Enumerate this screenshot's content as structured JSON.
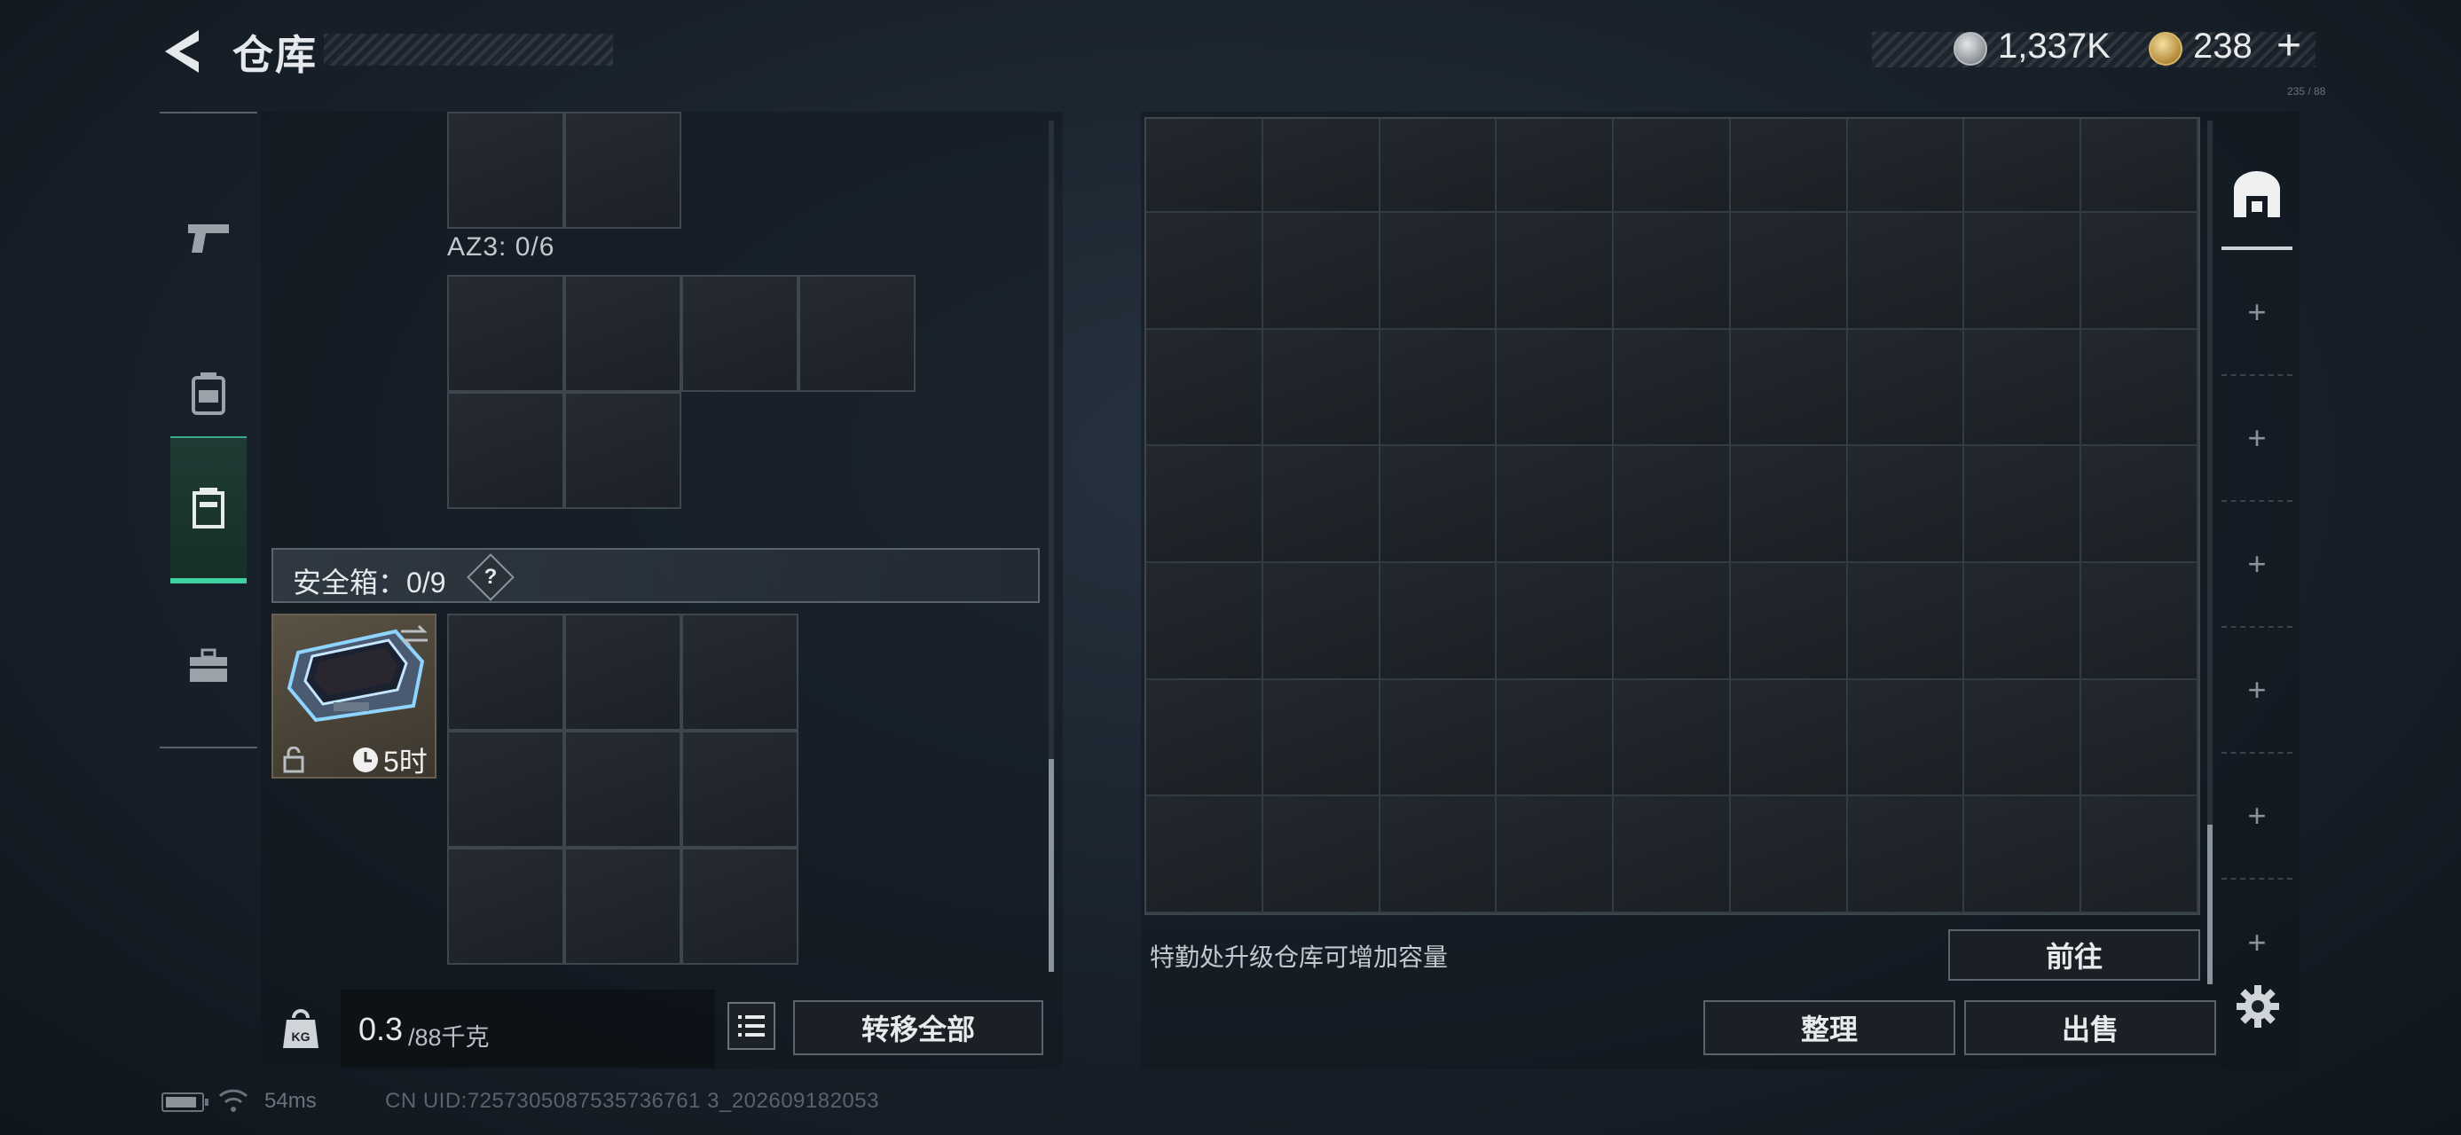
{
  "header": {
    "title": "仓库",
    "currency_silver": "1,337K",
    "currency_gold": "238",
    "currency_add": "+",
    "tiny_label": "235 / 88"
  },
  "left_nav": {
    "items": [
      {
        "name": "weapons",
        "icon": "pistol-icon"
      },
      {
        "name": "gear",
        "icon": "backpack-icon"
      },
      {
        "name": "containers",
        "icon": "case-icon",
        "active": true
      },
      {
        "name": "items",
        "icon": "toolbox-icon"
      }
    ]
  },
  "left_panel": {
    "az3_label": "AZ3: 0/6",
    "safebox_label": "安全箱：0/9",
    "safebox_help": "?",
    "safe_item_timer": "5时",
    "weight_current": "0.3",
    "weight_max": "/88千克",
    "transfer_all": "转移全部"
  },
  "right_panel": {
    "upgrade_hint": "特勤处升级仓库可增加容量",
    "goto": "前往",
    "sort": "整理",
    "sell": "出售",
    "plus_slots": [
      "+",
      "+",
      "+",
      "+",
      "+",
      "+"
    ]
  },
  "footer": {
    "ping": "54ms",
    "uid": "CN UID:7257305087535736761 3_202609182053"
  },
  "colors": {
    "accent_green": "#3fd0a4",
    "panel_border": "#5a646e",
    "cell_border": "#3e464e"
  }
}
